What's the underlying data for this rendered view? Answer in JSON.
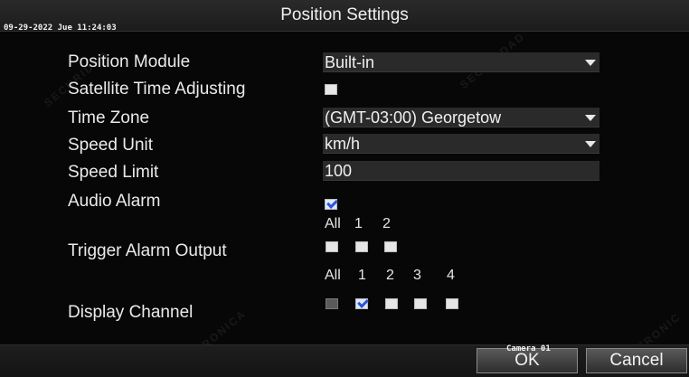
{
  "header": {
    "datetime": "09-29-2022 Jue 11:24:03",
    "title": "Position Settings"
  },
  "form": {
    "position_module": {
      "label": "Position Module",
      "value": "Built-in"
    },
    "satellite_time": {
      "label": "Satellite Time Adjusting",
      "checked": false
    },
    "time_zone": {
      "label": "Time Zone",
      "value": "(GMT-03:00) Georgetow"
    },
    "speed_unit": {
      "label": "Speed Unit",
      "value": "km/h"
    },
    "speed_limit": {
      "label": "Speed Limit",
      "value": "100"
    },
    "audio_alarm": {
      "label": "Audio Alarm",
      "checked": true
    },
    "trigger_alarm_output": {
      "label": "Trigger Alarm Output",
      "headers": [
        "All",
        "1",
        "2"
      ],
      "checked": [
        false,
        false,
        false
      ]
    },
    "display_channel": {
      "label": "Display Channel",
      "headers": [
        "All",
        "1",
        "2",
        "3",
        "4"
      ],
      "checked": [
        false,
        true,
        false,
        false,
        false
      ],
      "disabled": [
        true,
        false,
        false,
        false,
        false
      ]
    }
  },
  "footer": {
    "camera_label": "Camera 01",
    "ok_label": "OK",
    "cancel_label": "Cancel"
  },
  "colors": {
    "background": "#070707",
    "field": "#2a2a2a",
    "check_blue": "#2b55d6"
  }
}
